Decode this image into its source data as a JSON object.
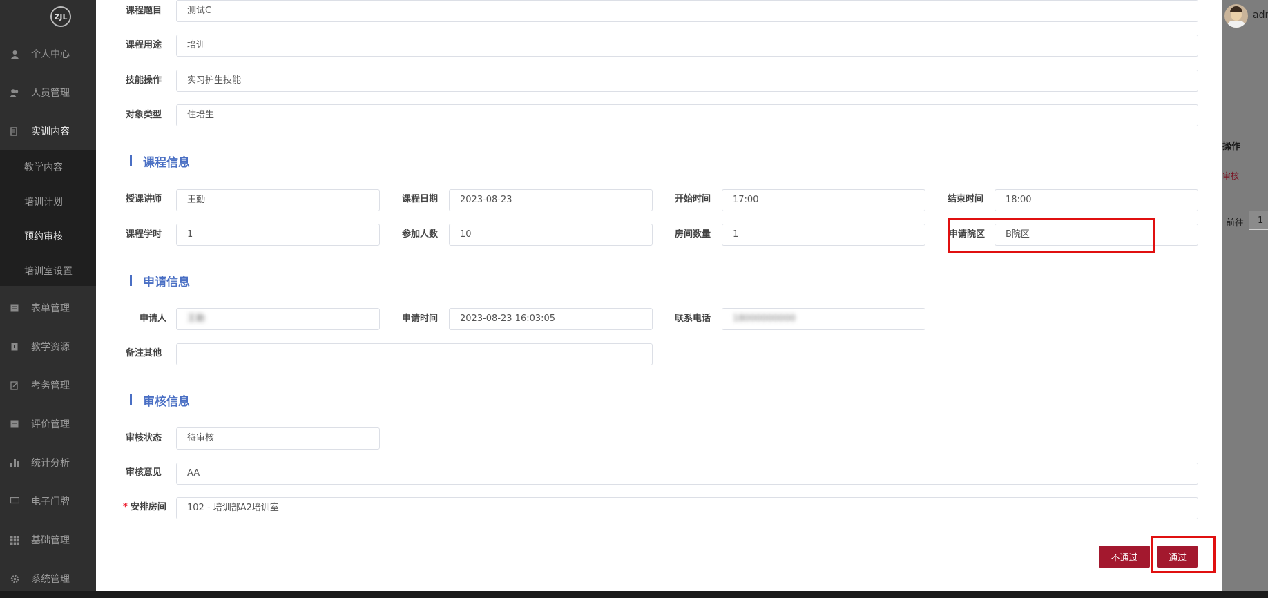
{
  "sidebar": {
    "logo": "ZJL",
    "items": [
      {
        "label": "个人中心",
        "icon": "user-icon"
      },
      {
        "label": "人员管理",
        "icon": "users-icon"
      },
      {
        "label": "实训内容",
        "icon": "book-icon"
      },
      {
        "label": "表单管理",
        "icon": "form-icon"
      },
      {
        "label": "教学资源",
        "icon": "resource-icon"
      },
      {
        "label": "考务管理",
        "icon": "exam-icon"
      },
      {
        "label": "评价管理",
        "icon": "rating-icon"
      },
      {
        "label": "统计分析",
        "icon": "bar-chart-icon"
      },
      {
        "label": "电子门牌",
        "icon": "door-sign-icon"
      },
      {
        "label": "基础管理",
        "icon": "grid-icon"
      },
      {
        "label": "系统管理",
        "icon": "gear-icon"
      }
    ],
    "sub_items": [
      {
        "label": "教学内容"
      },
      {
        "label": "培训计划"
      },
      {
        "label": "预约审核"
      },
      {
        "label": "培训室设置"
      }
    ]
  },
  "right": {
    "user": "adm",
    "col_header": "操作",
    "action": "审核",
    "goto": "前往",
    "page": "1"
  },
  "form": {
    "course_title_label": "课程题目",
    "course_title": "测试C",
    "course_use_label": "课程用途",
    "course_use": "培训",
    "skill_label": "技能操作",
    "skill": "实习护生技能",
    "target_label": "对象类型",
    "target": "住培生",
    "section_course": "课程信息",
    "teacher_label": "授课讲师",
    "teacher": "王勤",
    "date_label": "课程日期",
    "date": "2023-08-23",
    "start_label": "开始时间",
    "start": "17:00",
    "end_label": "结束时间",
    "end": "18:00",
    "hours_label": "课程学时",
    "hours": "1",
    "count_label": "参加人数",
    "count": "10",
    "rooms_label": "房间数量",
    "rooms": "1",
    "campus_label": "申请院区",
    "campus": "B院区",
    "section_apply": "申请信息",
    "applicant_label": "申请人",
    "applicant": "王勤",
    "apply_time_label": "申请时间",
    "apply_time": "2023-08-23 16:03:05",
    "phone_label": "联系电话",
    "phone": "18000000000",
    "remark_label": "备注其他",
    "remark": "",
    "section_review": "审核信息",
    "status_label": "审核状态",
    "status": "待审核",
    "opinion_label": "审核意见",
    "opinion": "AA",
    "room_label": "安排房间",
    "room": "102 - 培训部A2培训室",
    "required_mark": "*"
  },
  "actions": {
    "reject": "不通过",
    "approve": "通过"
  },
  "colors": {
    "accent": "#4a6fc4",
    "button": "#a3182e",
    "highlight": "#e01010"
  }
}
